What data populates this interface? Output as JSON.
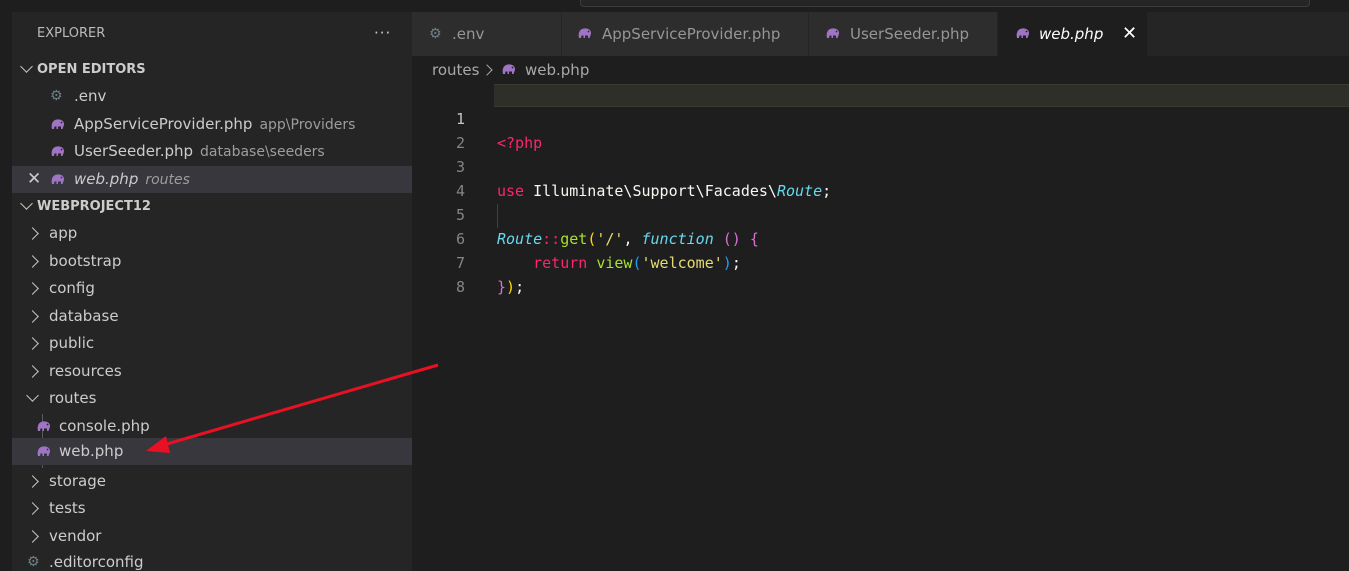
{
  "explorer": {
    "title": "EXPLORER",
    "more": "···",
    "open_editors": {
      "label": "OPEN EDITORS",
      "items": [
        {
          "name": ".env",
          "desc": ""
        },
        {
          "name": "AppServiceProvider.php",
          "desc": "app\\Providers"
        },
        {
          "name": "UserSeeder.php",
          "desc": "database\\seeders"
        },
        {
          "name": "web.php",
          "desc": "routes"
        }
      ]
    },
    "project": {
      "label": "WEBPROJECT12",
      "items": [
        {
          "name": "app"
        },
        {
          "name": "bootstrap"
        },
        {
          "name": "config"
        },
        {
          "name": "database"
        },
        {
          "name": "public"
        },
        {
          "name": "resources"
        },
        {
          "name": "routes"
        },
        {
          "name": "console.php"
        },
        {
          "name": "web.php"
        },
        {
          "name": "storage"
        },
        {
          "name": "tests"
        },
        {
          "name": "vendor"
        },
        {
          "name": ".editorconfig"
        }
      ]
    }
  },
  "tabs": [
    {
      "label": ".env"
    },
    {
      "label": "AppServiceProvider.php"
    },
    {
      "label": "UserSeeder.php"
    },
    {
      "label": "web.php",
      "close": "✕"
    }
  ],
  "breadcrumb": {
    "folder": "routes",
    "file": "web.php"
  },
  "editor": {
    "line_numbers": [
      "1",
      "2",
      "3",
      "4",
      "5",
      "6",
      "7",
      "8"
    ],
    "tokens": {
      "php_open": "<?php",
      "use": "use",
      "ns_path": " Illuminate\\Support\\Facades\\",
      "route_cls": "Route",
      "semicolon": ";",
      "route2": "Route",
      "dcolon": "::",
      "get": "get",
      "paren_open": "(",
      "slash_str": "'/'",
      "comma": ", ",
      "function_kw": "function",
      "space": " ",
      "pp": "()",
      "brace": " {",
      "indent": "    ",
      "return_kw": "return",
      "view_fn": " view",
      "paren_open2": "(",
      "welcome_str": "'welcome'",
      "paren_close2": ")",
      "semi2": ";",
      "close_brace": "}",
      "close_paren": ")",
      "semi3": ";"
    }
  },
  "colors": {
    "accent_arrow": "#e81123",
    "php_icon": "#a074c4"
  }
}
